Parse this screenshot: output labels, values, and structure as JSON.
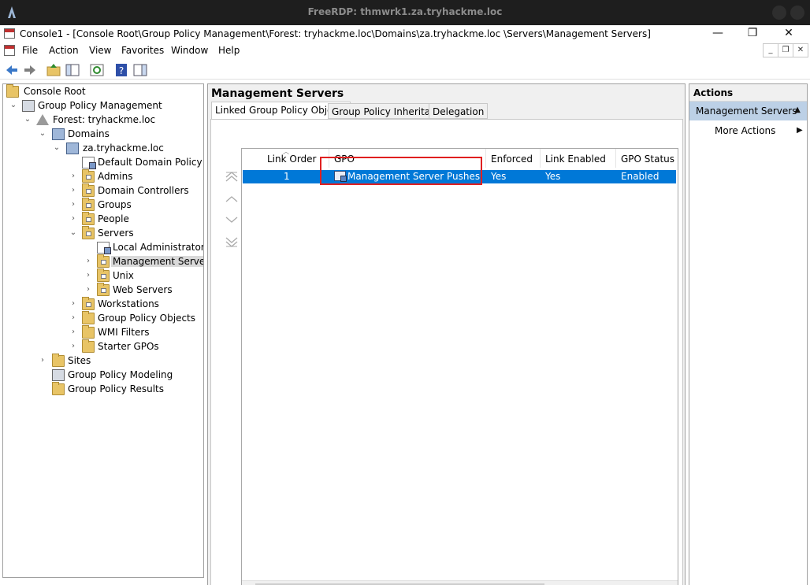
{
  "rdp": {
    "title": "FreeRDP: thmwrk1.za.tryhackme.loc"
  },
  "window": {
    "title": "Console1 - [Console Root\\Group Policy Management\\Forest: tryhackme.loc\\Domains\\za.tryhackme.loc \\Servers\\Management Servers]",
    "minimize": "—",
    "maximize": "❐",
    "close": "✕"
  },
  "menu": {
    "file": "File",
    "action": "Action",
    "view": "View",
    "favorites": "Favorites",
    "window": "Window",
    "help": "Help"
  },
  "tree": {
    "console_root": "Console Root",
    "gpm": "Group Policy Management",
    "forest": "Forest: tryhackme.loc",
    "domains": "Domains",
    "domain": "za.tryhackme.loc",
    "default_domain_policy": "Default Domain Policy",
    "admins": "Admins",
    "domain_controllers": "Domain Controllers",
    "groups": "Groups",
    "people": "People",
    "servers": "Servers",
    "local_admins": "Local Administrators -",
    "management_servers": "Management Servers",
    "unix": "Unix",
    "web_servers": "Web Servers",
    "workstations": "Workstations",
    "gpo_objects": "Group Policy Objects",
    "wmi_filters": "WMI Filters",
    "starter_gpos": "Starter GPOs",
    "sites": "Sites",
    "modeling": "Group Policy Modeling",
    "results": "Group Policy Results"
  },
  "main": {
    "title": "Management Servers",
    "tabs": {
      "linked": "Linked Group Policy Objects",
      "inheritance": "Group Policy Inheritance",
      "delegation": "Delegation"
    },
    "columns": {
      "link_order": "Link Order",
      "gpo": "GPO",
      "enforced": "Enforced",
      "link_enabled": "Link Enabled",
      "gpo_status": "GPO Status"
    },
    "rows": [
      {
        "link_order": "1",
        "gpo": "Management Server Pushes",
        "enforced": "Yes",
        "link_enabled": "Yes",
        "gpo_status": "Enabled"
      }
    ]
  },
  "actions": {
    "header": "Actions",
    "section": "Management Servers",
    "more": "More Actions"
  },
  "colors": {
    "selection": "#0078d7",
    "highlight_box": "#e02020",
    "actions_section": "#bcd0e6"
  }
}
